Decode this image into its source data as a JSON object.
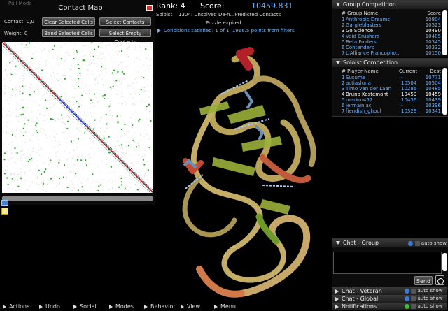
{
  "contact_map": {
    "mode_label": "Pull Mode",
    "title": "Contact Map",
    "contact_label": "Contact: 0,0",
    "weight_label": "Weight: 0",
    "buttons": [
      "Clear Selected Cells",
      "Select Contacts",
      "Band Selected Cells",
      "Select Empty Contacts"
    ]
  },
  "score_panel": {
    "rank": "Rank: 4",
    "score_label": "Score:",
    "score_value": "10459.831",
    "role": "Soloist",
    "puzzle_name": "1304: Unsolved De-n...Predicted Contacts",
    "status": "Puzzle expired",
    "conditions": "Conditions satisfied: 1 of 1, 1966.5 points from filters"
  },
  "group_competition": {
    "title": "Group Competition",
    "col_name": "# Group Name",
    "col_score": "Score",
    "rows": [
      {
        "rank": "1",
        "name": "Anthropic Dreams",
        "score": "10804",
        "highlight": false
      },
      {
        "rank": "2",
        "name": "Gargleblasters",
        "score": "10523",
        "highlight": false
      },
      {
        "rank": "3",
        "name": "Go Science",
        "score": "10490",
        "highlight": true
      },
      {
        "rank": "4",
        "name": "Void Crushers",
        "score": "10485",
        "highlight": false
      },
      {
        "rank": "5",
        "name": "Beta Folders",
        "score": "10345",
        "highlight": false
      },
      {
        "rank": "6",
        "name": "Contenders",
        "score": "10332",
        "highlight": false
      },
      {
        "rank": "7",
        "name": "L'Alliance Francopho...",
        "score": "10150",
        "highlight": false
      }
    ]
  },
  "soloist_competition": {
    "title": "Soloist Competition",
    "col_name": "# Player Name",
    "col_current": "Current",
    "col_best": "Best",
    "rows": [
      {
        "rank": "1",
        "name": "Susume",
        "current": "-",
        "best": "10771",
        "highlight": false
      },
      {
        "rank": "2",
        "name": "actiasluna",
        "current": "10504",
        "best": "10504",
        "highlight": false
      },
      {
        "rank": "3",
        "name": "Timo van der Laan",
        "current": "10286",
        "best": "10485",
        "highlight": false
      },
      {
        "rank": "4",
        "name": "Bruno Kestemont",
        "current": "10459",
        "best": "10459",
        "highlight": true
      },
      {
        "rank": "5",
        "name": "markm457",
        "current": "10436",
        "best": "10439",
        "highlight": false
      },
      {
        "rank": "6",
        "name": "jermainiac",
        "current": "-",
        "best": "10396",
        "highlight": false
      },
      {
        "rank": "7",
        "name": "fiendish_ghoul",
        "current": "10329",
        "best": "10341",
        "highlight": false
      }
    ]
  },
  "chat": {
    "group_title": "Chat - Group",
    "auto_show": "auto show",
    "send_label": "Send",
    "collapsed": [
      "Chat - Veteran",
      "Chat - Global",
      "Notifications"
    ]
  },
  "bottom_menu": [
    "Actions",
    "Undo",
    "Social",
    "Modes",
    "Behavior",
    "View",
    "Menu"
  ],
  "colors": {
    "accent_blue": "#5aa0ff",
    "panel_bg": "#0c0c0c",
    "highlight_text": "#ffffff"
  }
}
